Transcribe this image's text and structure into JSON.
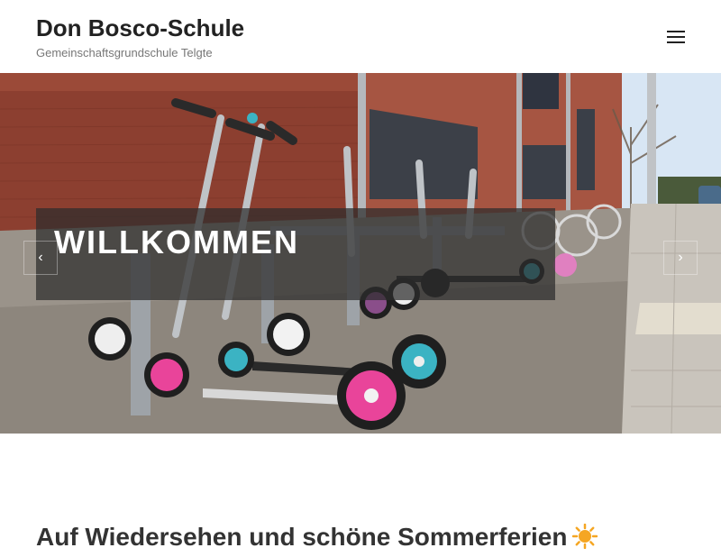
{
  "header": {
    "site_title": "Don Bosco-Schule",
    "tagline": "Gemeinschaftsgrundschule Telgte",
    "menu_icon": "hamburger-menu-icon"
  },
  "hero": {
    "caption": "WILLKOMMEN",
    "prev_label": "‹",
    "next_label": "›",
    "image_description_icon": "photo-scooters-in-schoolyard"
  },
  "content": {
    "heading": "Auf Wiedersehen und schöne Sommerferien",
    "heading_icon": "sun-emoji-icon"
  },
  "colors": {
    "text_dark": "#222222",
    "tagline": "#777777",
    "caption_overlay": "#2d2d2d",
    "sun": "#f5a623"
  }
}
